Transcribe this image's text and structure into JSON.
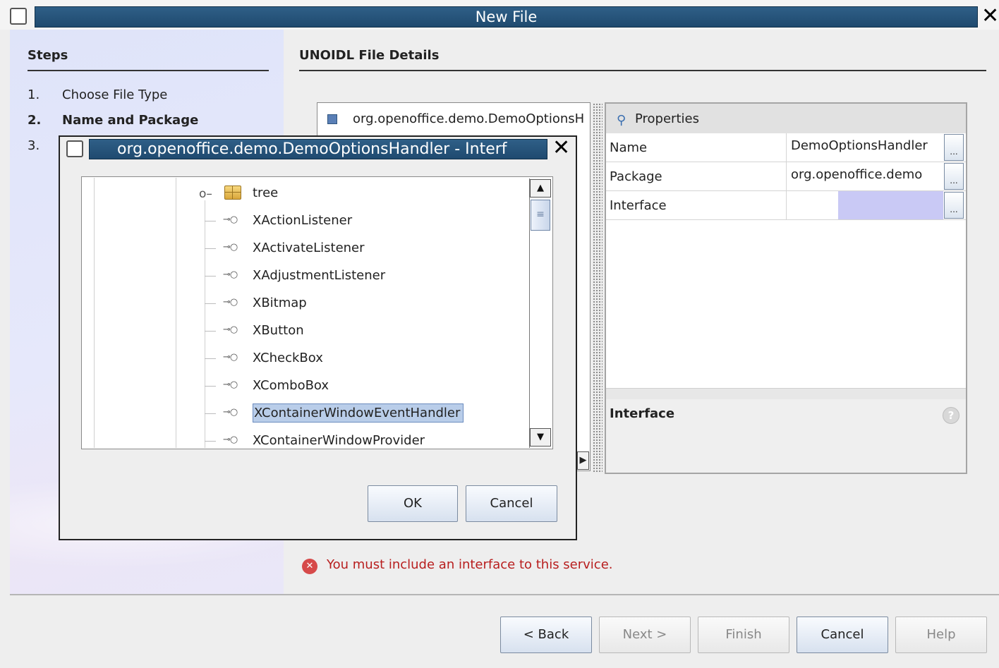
{
  "window": {
    "title": "New File",
    "close_glyph": "✕"
  },
  "steps": {
    "heading": "Steps",
    "items": [
      {
        "num": "1.",
        "label": "Choose File Type",
        "current": false
      },
      {
        "num": "2.",
        "label": "Name and Package",
        "current": true
      },
      {
        "num": "3.",
        "label": "",
        "current": false
      }
    ]
  },
  "details": {
    "heading": "UNOIDL File Details",
    "tree_item": "org.openoffice.demo.DemoOptionsH",
    "properties": {
      "header": "Properties",
      "rows": [
        {
          "name": "Name",
          "value": "DemoOptionsHandler",
          "button": "..."
        },
        {
          "name": "Package",
          "value": "org.openoffice.demo",
          "button": "..."
        },
        {
          "name": "Interface",
          "value": "",
          "button": "..."
        }
      ]
    },
    "description_title": "Interface",
    "help_glyph": "?"
  },
  "error": {
    "icon_glyph": "✕",
    "message": "You must include an interface to this service."
  },
  "footer": {
    "back": "< Back",
    "next": "Next >",
    "finish": "Finish",
    "cancel": "Cancel",
    "help": "Help"
  },
  "dialog": {
    "title": "org.openoffice.demo.DemoOptionsHandler - Interf",
    "close_glyph": "✕",
    "tree_root": "tree",
    "interfaces": [
      "XActionListener",
      "XActivateListener",
      "XAdjustmentListener",
      "XBitmap",
      "XButton",
      "XCheckBox",
      "XComboBox",
      "XContainerWindowEventHandler",
      "XContainerWindowProvider"
    ],
    "selected_interface": "XContainerWindowEventHandler",
    "ok": "OK",
    "cancel": "Cancel",
    "interface_icon_glyph": "⊸○",
    "scroll_up": "▲",
    "scroll_down": "▼",
    "scroll_thumb": "≡"
  },
  "colors": {
    "titlebar": "#2f5f87",
    "selection": "#b9cde9",
    "error": "#b81e1e",
    "interface_cell_highlight": "#c9c9f5"
  }
}
